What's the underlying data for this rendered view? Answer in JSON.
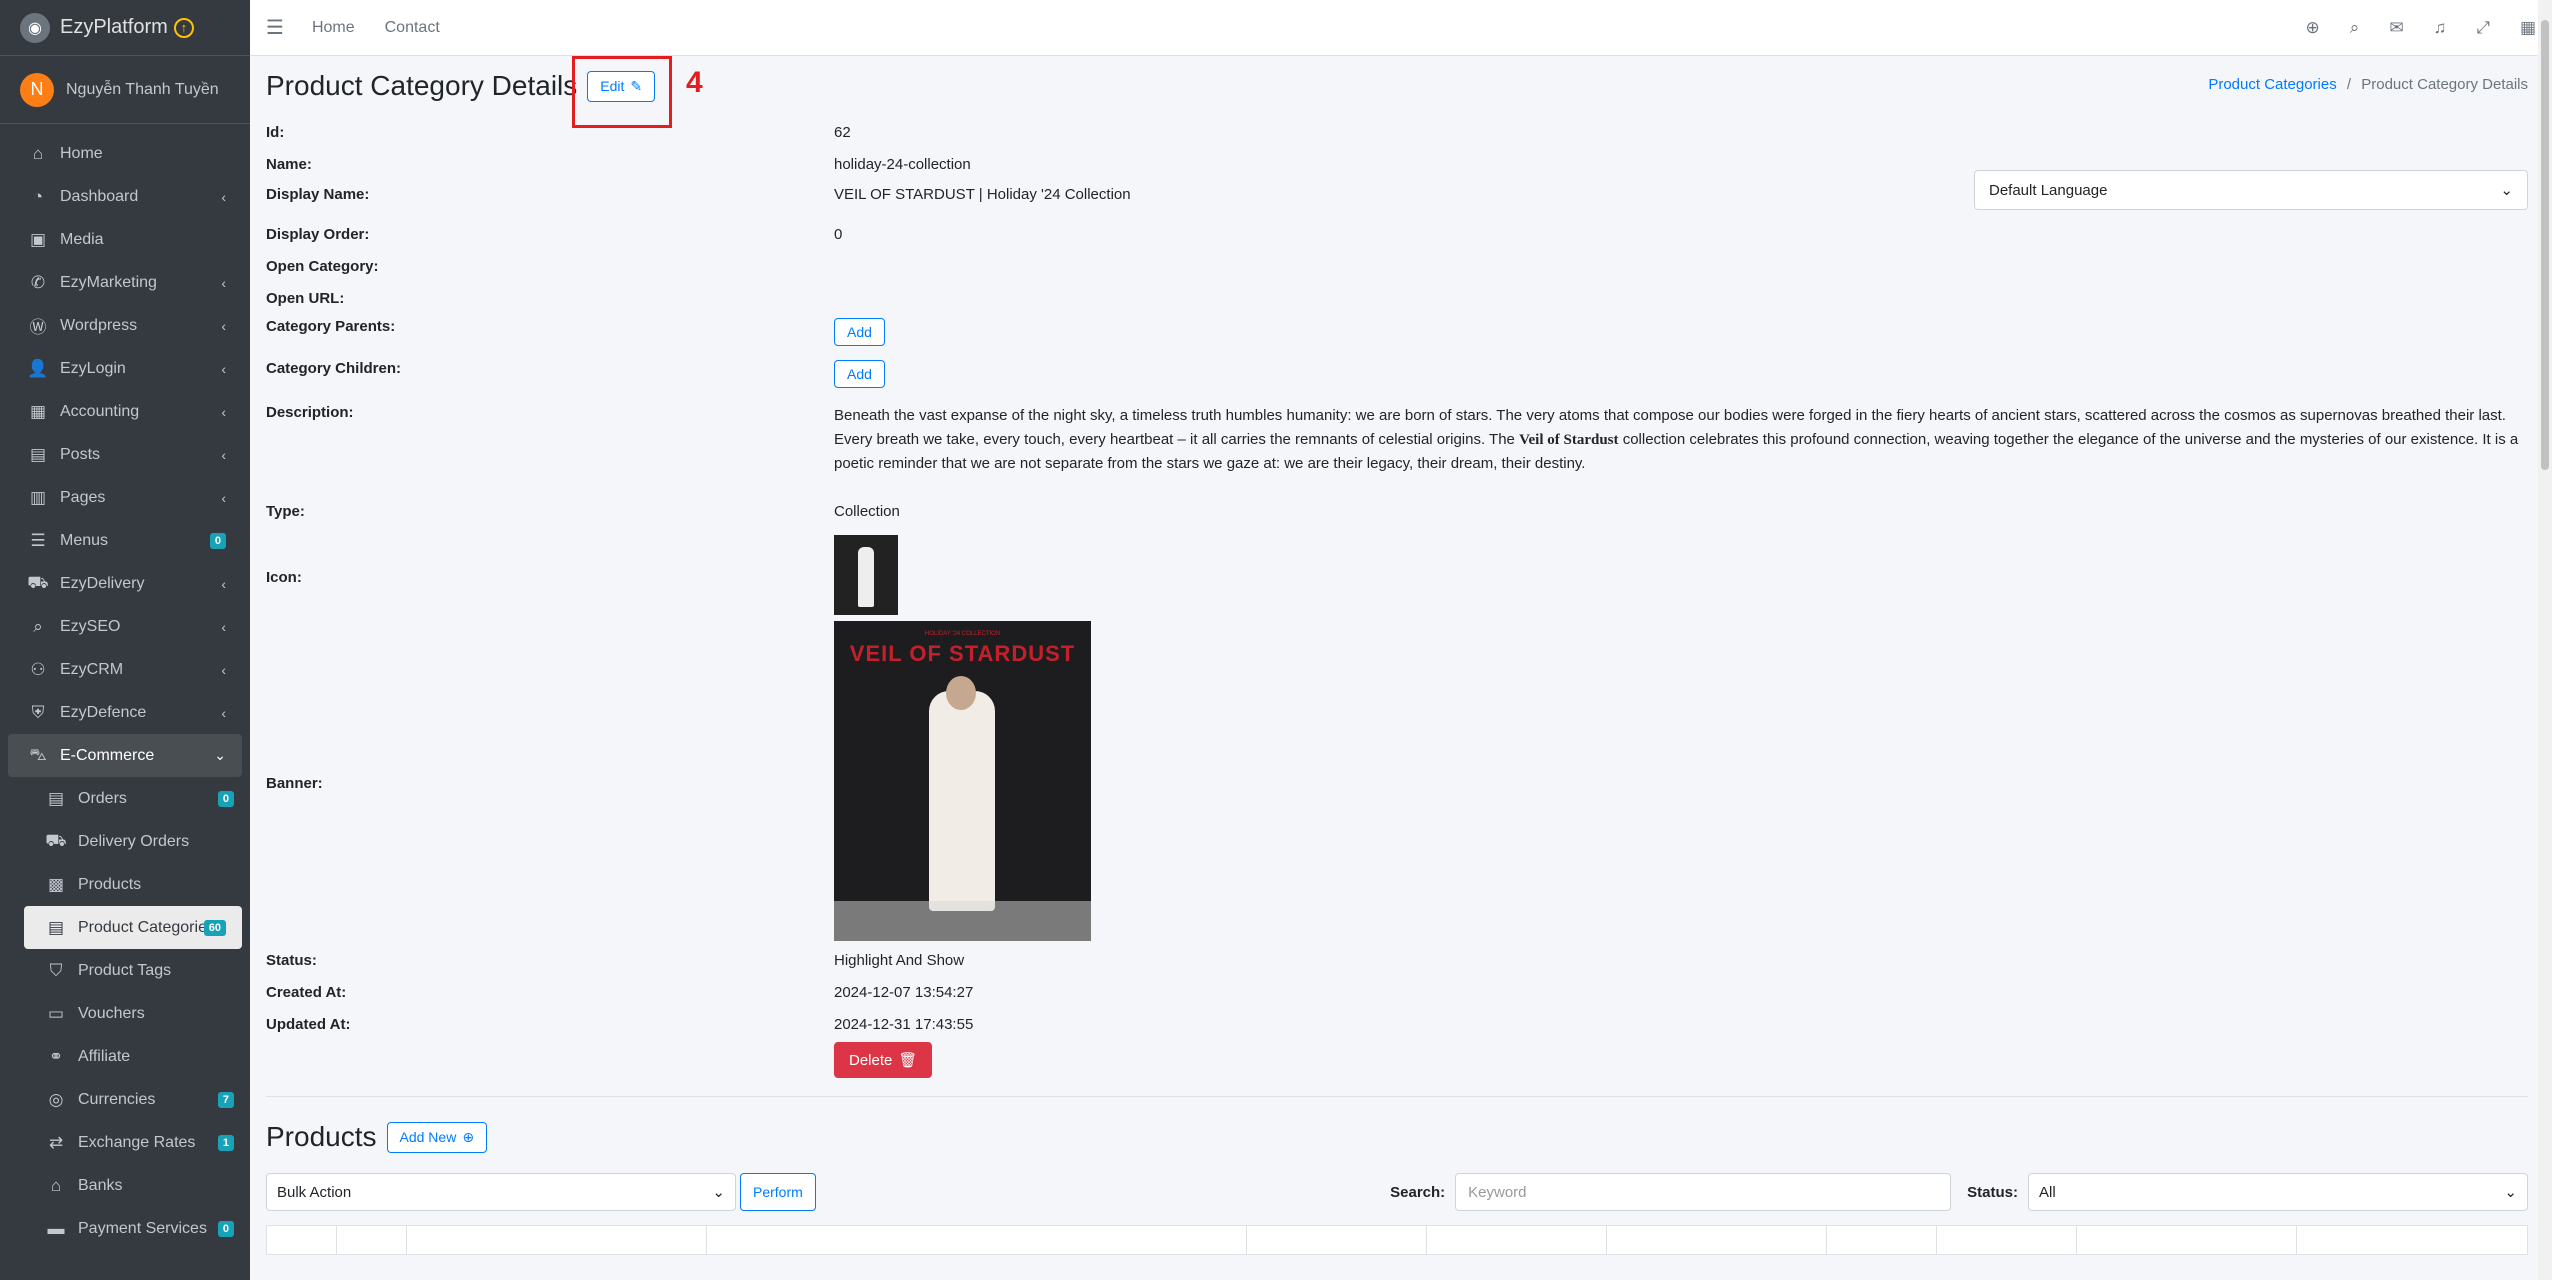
{
  "brand": {
    "name": "EzyPlatform",
    "badge": "↑"
  },
  "user": {
    "initial": "N",
    "name": "Nguyễn Thanh Tuyền"
  },
  "sidebar": {
    "items": [
      {
        "label": "Home",
        "icon": "home-icon"
      },
      {
        "label": "Dashboard",
        "icon": "dashboard-icon"
      },
      {
        "label": "Media",
        "icon": "image-icon"
      },
      {
        "label": "EzyMarketing",
        "icon": "megaphone-icon"
      },
      {
        "label": "Wordpress",
        "icon": "wordpress-icon"
      },
      {
        "label": "EzyLogin",
        "icon": "user-lock-icon"
      },
      {
        "label": "Accounting",
        "icon": "calculator-icon"
      },
      {
        "label": "Posts",
        "icon": "posts-icon"
      },
      {
        "label": "Pages",
        "icon": "pages-icon"
      },
      {
        "label": "Menus",
        "icon": "menu-icon",
        "badge": "0"
      },
      {
        "label": "EzyDelivery",
        "icon": "truck-icon"
      },
      {
        "label": "EzySEO",
        "icon": "seo-search-icon"
      },
      {
        "label": "EzyCRM",
        "icon": "crm-icon"
      },
      {
        "label": "EzyDefence",
        "icon": "shield-icon"
      },
      {
        "label": "E-Commerce",
        "icon": "basket-icon"
      }
    ],
    "sub_items": [
      {
        "label": "Orders",
        "icon": "orders-icon",
        "badge": "0"
      },
      {
        "label": "Delivery Orders",
        "icon": "delivery-icon"
      },
      {
        "label": "Products",
        "icon": "boxes-icon"
      },
      {
        "label": "Product Categories",
        "icon": "clipboard-icon",
        "badge": "60"
      },
      {
        "label": "Product Tags",
        "icon": "tag-icon"
      },
      {
        "label": "Vouchers",
        "icon": "voucher-icon"
      },
      {
        "label": "Affiliate",
        "icon": "link-icon"
      },
      {
        "label": "Currencies",
        "icon": "coins-icon",
        "badge": "7"
      },
      {
        "label": "Exchange Rates",
        "icon": "exchange-icon",
        "badge": "1"
      },
      {
        "label": "Banks",
        "icon": "bank-icon"
      },
      {
        "label": "Payment Services",
        "icon": "payment-icon",
        "badge": "0"
      }
    ]
  },
  "topbar": {
    "home": "Home",
    "contact": "Contact"
  },
  "page": {
    "title": "Product Category Details",
    "edit_label": "Edit",
    "annotation": "4",
    "breadcrumb_link": "Product Categories",
    "breadcrumb_sep": "/",
    "breadcrumb_current": "Product Category Details"
  },
  "language_select": "Default Language",
  "details": {
    "id_label": "Id:",
    "id": "62",
    "name_label": "Name:",
    "name": "holiday-24-collection",
    "display_name_label": "Display Name:",
    "display_name": "VEIL OF STARDUST | Holiday '24 Collection",
    "display_order_label": "Display Order:",
    "display_order": "0",
    "open_category_label": "Open Category:",
    "open_url_label": "Open URL:",
    "parents_label": "Category Parents:",
    "children_label": "Category Children:",
    "add_label": "Add",
    "description_label": "Description:",
    "description_1": "Beneath the vast expanse of the night sky, a timeless truth humbles humanity: we are born of stars. The very atoms that compose our bodies were forged in the fiery hearts of ancient stars, scattered across the cosmos as supernovas breathed their last. Every breath we take, every touch, every heartbeat – it all carries the remnants of celestial origins. The ",
    "description_bold": "Veil of Stardust",
    "description_2": " collection celebrates this profound connection, weaving together the elegance of the universe and the mysteries of our existence. It is a poetic reminder that we are not separate from the stars we gaze at: we are their legacy, their dream, their destiny.",
    "type_label": "Type:",
    "type": "Collection",
    "icon_label": "Icon:",
    "banner_label": "Banner:",
    "banner_title": "VEIL OF STARDUST",
    "banner_subtitle": "HOLIDAY '24 COLLECTION",
    "status_label": "Status:",
    "status": "Highlight And Show",
    "created_label": "Created At:",
    "created": "2024-12-07 13:54:27",
    "updated_label": "Updated At:",
    "updated": "2024-12-31 17:43:55",
    "delete_label": "Delete"
  },
  "products": {
    "title": "Products",
    "add_new": "Add New",
    "bulk_action": "Bulk Action",
    "perform": "Perform",
    "search_label": "Search:",
    "search_placeholder": "Keyword",
    "status_label": "Status:",
    "status_value": "All"
  },
  "colors": {
    "accent": "#007bff",
    "danger": "#dc3545",
    "sidebar": "#343a40",
    "annotation": "#e41e1e"
  }
}
